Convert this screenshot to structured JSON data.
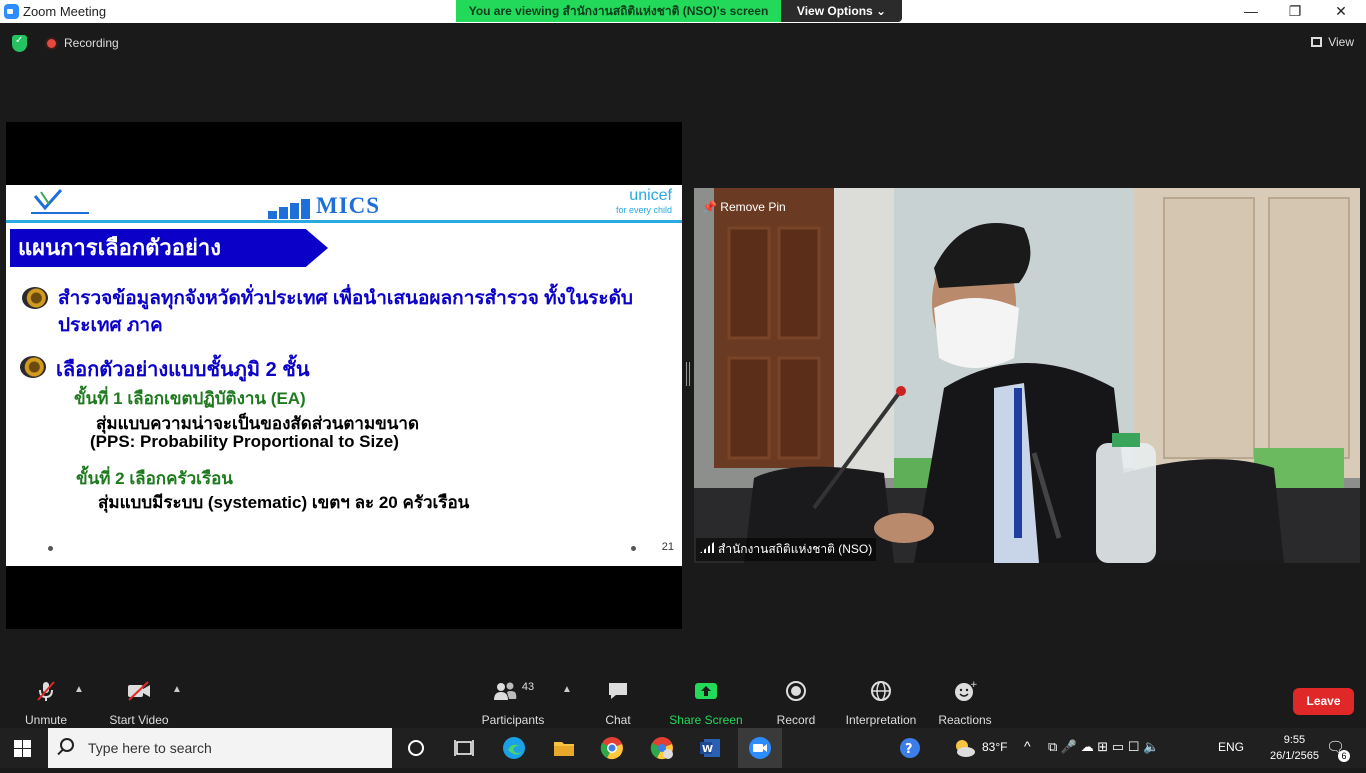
{
  "window": {
    "title": "Zoom Meeting",
    "viewing_banner": "You are viewing สำนักงานสถิติแห่งชาติ (NSO)'s screen",
    "view_options": "View Options ⌄",
    "minimize": "—",
    "restore": "❐",
    "close": "✕"
  },
  "topbar": {
    "recording": "Recording",
    "view": "View"
  },
  "slide": {
    "logo_text": "MICS",
    "unicef_name": "unicef",
    "unicef_tag": "for every child",
    "title": "แผนการเลือกตัวอย่าง",
    "bullet1": "สำรวจข้อมูลทุกจังหวัดทั่วประเทศ เพื่อนำเสนอผลการสำรวจ ทั้งในระดับประเทศ ภาค",
    "bullet2": "เลือกตัวอย่างแบบชั้นภูมิ 2 ชั้น",
    "stage1_heading": "ขั้นที่ 1 เลือกเขตปฏิบัติงาน (EA)",
    "stage1_line1": "สุ่มแบบความน่าจะเป็นของสัดส่วนตามขนาด",
    "stage1_line2": "(PPS: Probability Proportional to Size)",
    "stage2_heading": "ขั้นที่ 2 เลือกครัวเรือน",
    "stage2_line1": "สุ่มแบบมีระบบ (systematic) เขตฯ ละ 20 ครัวเรือน",
    "page_number": "21"
  },
  "video": {
    "remove_pin": "Remove Pin",
    "participant_name": "สำนักงานสถิติแห่งชาติ (NSO)"
  },
  "toolbar": {
    "unmute": "Unmute",
    "start_video": "Start Video",
    "participants": "Participants",
    "participants_count": "43",
    "chat": "Chat",
    "share_screen": "Share Screen",
    "record": "Record",
    "interpretation": "Interpretation",
    "reactions": "Reactions",
    "leave": "Leave"
  },
  "taskbar": {
    "search_placeholder": "Type here to search",
    "weather": "83°F",
    "language": "ENG",
    "time": "9:55",
    "date": "26/1/2565",
    "notifications": "6"
  },
  "colors": {
    "banner_green": "#23d959",
    "share_green": "#23d959",
    "leave_red": "#e02828",
    "slide_blue": "#0b00c8",
    "slide_green": "#1f7a1f"
  }
}
